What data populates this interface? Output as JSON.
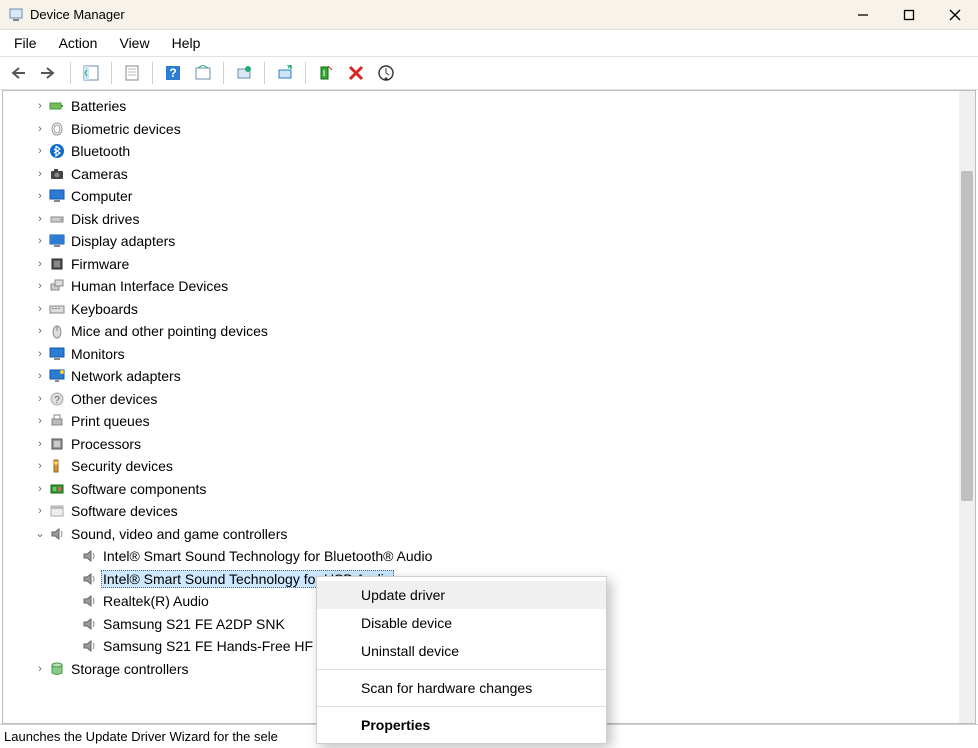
{
  "window": {
    "title": "Device Manager"
  },
  "menu": {
    "file": "File",
    "action": "Action",
    "view": "View",
    "help": "Help"
  },
  "toolbar": {
    "back": "back-icon",
    "forward": "forward-icon",
    "show_hide": "show-hide-icon",
    "properties": "properties-icon",
    "help": "help-icon",
    "refresh_sm": "action-center-icon",
    "update": "update-driver-icon",
    "enable": "enable-icon",
    "add": "add-legacy-icon",
    "remove": "uninstall-icon",
    "scan": "scan-hardware-icon"
  },
  "tree": {
    "categories": [
      {
        "label": "Batteries",
        "icon": "battery-icon",
        "expanded": false,
        "children": []
      },
      {
        "label": "Biometric devices",
        "icon": "fingerprint-icon",
        "expanded": false,
        "children": []
      },
      {
        "label": "Bluetooth",
        "icon": "bluetooth-icon",
        "expanded": false,
        "children": []
      },
      {
        "label": "Cameras",
        "icon": "camera-icon",
        "expanded": false,
        "children": []
      },
      {
        "label": "Computer",
        "icon": "monitor-icon",
        "expanded": false,
        "children": []
      },
      {
        "label": "Disk drives",
        "icon": "drive-icon",
        "expanded": false,
        "children": []
      },
      {
        "label": "Display adapters",
        "icon": "display-icon",
        "expanded": false,
        "children": []
      },
      {
        "label": "Firmware",
        "icon": "chip-icon",
        "expanded": false,
        "children": []
      },
      {
        "label": "Human Interface Devices",
        "icon": "hid-icon",
        "expanded": false,
        "children": []
      },
      {
        "label": "Keyboards",
        "icon": "keyboard-icon",
        "expanded": false,
        "children": []
      },
      {
        "label": "Mice and other pointing devices",
        "icon": "mouse-icon",
        "expanded": false,
        "children": []
      },
      {
        "label": "Monitors",
        "icon": "monitor-icon",
        "expanded": false,
        "children": []
      },
      {
        "label": "Network adapters",
        "icon": "network-icon",
        "expanded": false,
        "children": []
      },
      {
        "label": "Other devices",
        "icon": "unknown-icon",
        "expanded": false,
        "children": []
      },
      {
        "label": "Print queues",
        "icon": "printer-icon",
        "expanded": false,
        "children": []
      },
      {
        "label": "Processors",
        "icon": "cpu-icon",
        "expanded": false,
        "children": []
      },
      {
        "label": "Security devices",
        "icon": "security-icon",
        "expanded": false,
        "children": []
      },
      {
        "label": "Software components",
        "icon": "component-icon",
        "expanded": false,
        "children": []
      },
      {
        "label": "Software devices",
        "icon": "software-icon",
        "expanded": false,
        "children": []
      },
      {
        "label": "Sound, video and game controllers",
        "icon": "speaker-icon",
        "expanded": true,
        "children": [
          {
            "label": "Intel® Smart Sound Technology for Bluetooth® Audio",
            "icon": "speaker-icon",
            "selected": false
          },
          {
            "label": "Intel® Smart Sound Technology for USB Audio",
            "icon": "speaker-icon",
            "selected": true
          },
          {
            "label": "Realtek(R) Audio",
            "icon": "speaker-icon",
            "selected": false
          },
          {
            "label": "Samsung S21 FE A2DP SNK",
            "icon": "speaker-icon",
            "selected": false
          },
          {
            "label": "Samsung S21 FE Hands-Free HF",
            "icon": "speaker-icon",
            "selected": false
          }
        ]
      },
      {
        "label": "Storage controllers",
        "icon": "storage-icon",
        "expanded": false,
        "children": []
      }
    ]
  },
  "context_menu": {
    "items": [
      {
        "label": "Update driver",
        "hover": true
      },
      {
        "label": "Disable device"
      },
      {
        "label": "Uninstall device"
      },
      {
        "divider": true
      },
      {
        "label": "Scan for hardware changes"
      },
      {
        "divider": true
      },
      {
        "label": "Properties",
        "bold": true
      }
    ]
  },
  "status": {
    "text": "Launches the Update Driver Wizard for the sele"
  }
}
